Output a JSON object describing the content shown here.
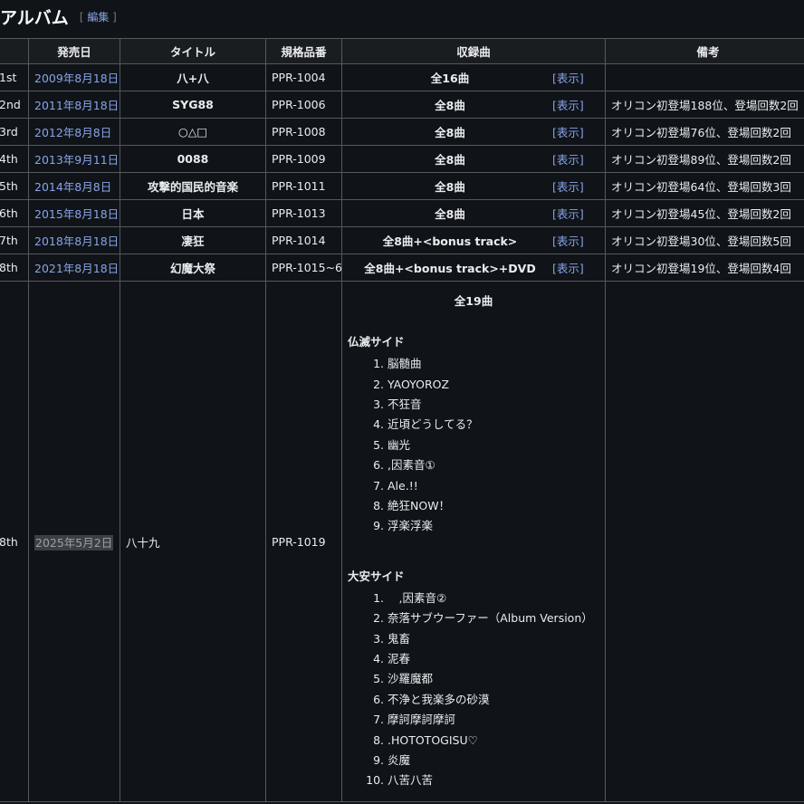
{
  "heading": {
    "title": "アルバム",
    "edit_open": "[",
    "edit_label": "編集",
    "edit_close": "]"
  },
  "columns": [
    "",
    "発売日",
    "タイトル",
    "規格品番",
    "収録曲",
    "備考"
  ],
  "rows": [
    {
      "num": "1st",
      "date": "2009年8月18日",
      "title": "八+八",
      "catalog": "PPR-1004",
      "tracks": "全16曲",
      "toggle": "[表示]",
      "note": ""
    },
    {
      "num": "2nd",
      "date": "2011年8月18日",
      "title": "SYG88",
      "catalog": "PPR-1006",
      "tracks": "全8曲",
      "toggle": "[表示]",
      "note": "オリコン初登場188位、登場回数2回"
    },
    {
      "num": "3rd",
      "date": "2012年8月8日",
      "title": "○△□",
      "catalog": "PPR-1008",
      "tracks": "全8曲",
      "toggle": "[表示]",
      "note": "オリコン初登場76位、登場回数2回"
    },
    {
      "num": "4th",
      "date": "2013年9月11日",
      "title": "0088",
      "catalog": "PPR-1009",
      "tracks": "全8曲",
      "toggle": "[表示]",
      "note": "オリコン初登場89位、登場回数2回"
    },
    {
      "num": "5th",
      "date": "2014年8月8日",
      "title": "攻撃的国民的音楽",
      "catalog": "PPR-1011",
      "tracks": "全8曲",
      "toggle": "[表示]",
      "note": "オリコン初登場64位、登場回数3回"
    },
    {
      "num": "6th",
      "date": "2015年8月18日",
      "title": "日本",
      "catalog": "PPR-1013",
      "tracks": "全8曲",
      "toggle": "[表示]",
      "note": "オリコン初登場45位、登場回数2回"
    },
    {
      "num": "7th",
      "date": "2018年8月18日",
      "title": "凄狂",
      "catalog": "PPR-1014",
      "tracks": "全8曲+<bonus track>",
      "toggle": "[表示]",
      "note": "オリコン初登場30位、登場回数5回"
    },
    {
      "num": "8th",
      "date": "2021年8月18日",
      "title": "幻魔大祭",
      "catalog": "PPR-1015~6",
      "tracks": "全8曲+<bonus track>+DVD",
      "toggle": "[表示]",
      "note": "オリコン初登場19位、登場回数4回"
    }
  ],
  "last": {
    "num": "8th",
    "date": "2025年5月2日",
    "title": "八十九",
    "catalog": "PPR-1019",
    "total": "全19曲",
    "side1_title": "仏滅サイド",
    "side1": [
      "脳髄曲",
      "YAOYOROZ",
      "不狂音",
      "近頃どうしてる？",
      "幽光",
      ",因素音①",
      "Ale.!!",
      "絶狂NOW！",
      "浮楽浮楽"
    ],
    "side2_title": "大安サイド",
    "side2": [
      "　,因素音②",
      "奈落サブウーファー（Album Version）",
      "鬼畜",
      "泥春",
      "沙羅魔都",
      "不浄と我楽多の砂漠",
      "摩訶摩訶摩訶",
      ".HOTOTOGISU♡",
      "炎魔",
      "八苦八苦"
    ]
  }
}
